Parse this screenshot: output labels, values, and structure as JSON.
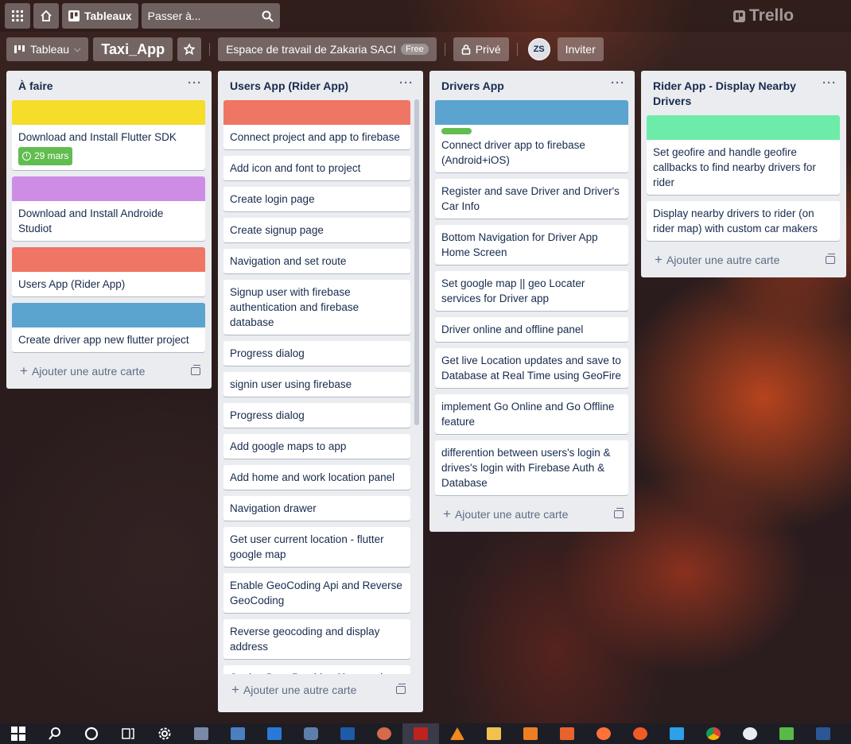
{
  "topbar": {
    "boards_label": "Tableaux",
    "search_placeholder": "Passer à...",
    "logo_text": "Trello"
  },
  "boardbar": {
    "view_label": "Tableau",
    "board_title": "Taxi_App",
    "workspace_label": "Espace de travail de Zakaria SACI",
    "workspace_badge": "Free",
    "visibility_label": "Privé",
    "avatar_initials": "ZS",
    "invite_label": "Inviter"
  },
  "add_card_label": "Ajouter une autre carte",
  "lists": [
    {
      "title": "À faire",
      "cards": [
        {
          "cover": "#f5dd29",
          "text": "Download and Install Flutter SDK",
          "due": "29 mars"
        },
        {
          "cover": "#cd8de5",
          "text": "Download and Install Androide Studiot"
        },
        {
          "cover": "#ef7564",
          "text": "Users App (Rider App)"
        },
        {
          "cover": "#5ba4cf",
          "text": "Create driver app new flutter project"
        }
      ]
    },
    {
      "title": "Users App (Rider App)",
      "cards": [
        {
          "cover": "#ef7564",
          "text": "Connect project and app to firebase"
        },
        {
          "text": "Add icon and font to project"
        },
        {
          "text": "Create login page"
        },
        {
          "text": "Create signup page"
        },
        {
          "text": "Navigation and set route"
        },
        {
          "text": "Signup user with firebase authentication and firebase database"
        },
        {
          "text": "Progress dialog"
        },
        {
          "text": "signin user using firebase"
        },
        {
          "text": "Progress dialog"
        },
        {
          "text": "Add google maps to app"
        },
        {
          "text": "Add home and work location panel"
        },
        {
          "text": "Navigation drawer"
        },
        {
          "text": "Get user current location - flutter google map"
        },
        {
          "text": "Enable GeoCoding Api and Reverse GeoCoding"
        },
        {
          "text": "Reverse geocoding and display address"
        },
        {
          "text": "Setting Data Provider Class and save Current Location Address"
        }
      ]
    },
    {
      "title": "Drivers App",
      "cards": [
        {
          "cover": "#5ba4cf",
          "label": "#61bd4f",
          "text": "Connect driver app to firebase (Android+iOS)"
        },
        {
          "text": "Register and save Driver and Driver's Car Info"
        },
        {
          "text": "Bottom Navigation for Driver App Home Screen"
        },
        {
          "text": "Set google map || geo Locater services for Driver app"
        },
        {
          "text": "Driver online and offline panel"
        },
        {
          "text": "Get live Location updates and save to Database at Real Time using GeoFire"
        },
        {
          "text": "implement Go Online and Go Offline feature"
        },
        {
          "text": "differention between users's login & drives's login with Firebase Auth & Database"
        }
      ]
    },
    {
      "title": "Rider App - Display Nearby Drivers",
      "cards": [
        {
          "cover": "#6deca9",
          "text": "Set geofire and handle geofire callbacks to find nearby drivers for rider"
        },
        {
          "text": "Display nearby drivers to rider (on rider map) with custom car makers"
        }
      ]
    }
  ],
  "taskbar_icons": [
    "windows-start",
    "search",
    "cortana",
    "task-view",
    "settings",
    "photos",
    "network",
    "calendar",
    "camera",
    "powershell",
    "paint",
    "acrobat",
    "vlc",
    "file-explorer",
    "sublime",
    "xampp",
    "firefox",
    "postman",
    "vscode",
    "chrome",
    "app-w",
    "app-green",
    "word"
  ]
}
